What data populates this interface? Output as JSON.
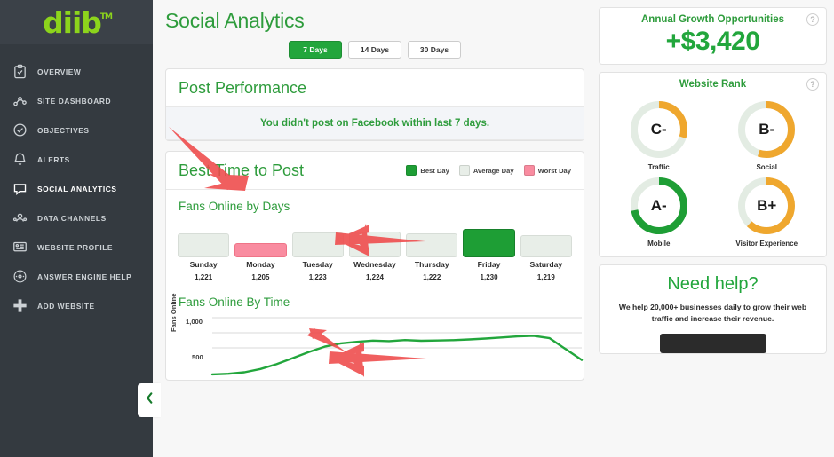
{
  "sidebar": {
    "logo": {
      "text": "diib",
      "tm": "TM",
      "color": "#8cd41c"
    },
    "items": [
      {
        "label": "Overview",
        "icon": "clipboard-check-icon",
        "active": false
      },
      {
        "label": "Site Dashboard",
        "icon": "network-graph-icon",
        "active": false
      },
      {
        "label": "Objectives",
        "icon": "check-circle-icon",
        "active": false
      },
      {
        "label": "Alerts",
        "icon": "bell-icon",
        "active": false
      },
      {
        "label": "Social Analytics",
        "icon": "chat-bubble-icon",
        "active": true
      },
      {
        "label": "Data Channels",
        "icon": "users-icon",
        "active": false
      },
      {
        "label": "Website Profile",
        "icon": "monitor-icon",
        "active": false
      },
      {
        "label": "Answer Engine Help",
        "icon": "compass-icon",
        "active": false
      },
      {
        "label": "Add Website",
        "icon": "plus-icon",
        "active": false
      }
    ],
    "collapse_icon": "chevron-left-icon"
  },
  "header": {
    "title": "Social Analytics"
  },
  "range_tabs": [
    {
      "label": "7 Days",
      "active": true
    },
    {
      "label": "14 Days",
      "active": false
    },
    {
      "label": "30 Days",
      "active": false
    }
  ],
  "post_performance": {
    "title": "Post Performance",
    "notice": "You didn't post on Facebook within last 7 days."
  },
  "best_time": {
    "title": "Best Time to Post",
    "legend": [
      {
        "label": "Best Day",
        "color": "#1e9e35"
      },
      {
        "label": "Average Day",
        "color": "#e8eee8"
      },
      {
        "label": "Worst Day",
        "color": "#f98ca0"
      }
    ],
    "fans_by_days_title": "Fans Online by Days",
    "fans_by_time_title": "Fans Online By Time"
  },
  "chart_data": [
    {
      "type": "bar",
      "title": "Fans Online by Days",
      "categories": [
        "Sunday",
        "Monday",
        "Tuesday",
        "Wednesday",
        "Thursday",
        "Friday",
        "Saturday"
      ],
      "values": [
        1221,
        1205,
        1223,
        1224,
        1222,
        1230,
        1219
      ],
      "value_labels": [
        "1,221",
        "1,205",
        "1,223",
        "1,224",
        "1,222",
        "1,230",
        "1,219"
      ],
      "statuses": [
        "average",
        "worst",
        "average",
        "average",
        "average",
        "best",
        "average"
      ],
      "colors": [
        "#e8eee8",
        "#f98ca0",
        "#e8eee8",
        "#e8eee8",
        "#e8eee8",
        "#1e9e35",
        "#e8eee8"
      ],
      "xlabel": "",
      "ylabel": "",
      "grid": false,
      "legend_position": "top-right"
    },
    {
      "type": "line",
      "title": "Fans Online By Time",
      "ylabel": "Fans Online",
      "xlabel": "",
      "ylim": [
        0,
        1000
      ],
      "yticks": [
        500,
        1000
      ],
      "ytick_labels": [
        "500",
        "1,000"
      ],
      "grid": true,
      "series": [
        {
          "name": "Fans Online",
          "color": "#22a63c",
          "values": [
            60,
            70,
            95,
            150,
            230,
            330,
            430,
            520,
            575,
            600,
            620,
            612,
            630,
            618,
            622,
            628,
            640,
            655,
            672,
            690,
            700,
            660,
            480,
            300
          ]
        }
      ]
    }
  ],
  "right_panel": {
    "growth": {
      "title": "Annual Growth Opportunities",
      "value": "+$3,420",
      "help_icon": "question-mark-icon"
    },
    "website_rank": {
      "title": "Website Rank",
      "help_icon": "question-mark-icon",
      "gauges": [
        {
          "label": "Traffic",
          "grade": "C-",
          "percent": 30,
          "color": "#efa72e"
        },
        {
          "label": "Social",
          "grade": "B-",
          "percent": 55,
          "color": "#efa72e"
        },
        {
          "label": "Mobile",
          "grade": "A-",
          "percent": 72,
          "color": "#1e9e35"
        },
        {
          "label": "Visitor Experience",
          "grade": "B+",
          "percent": 62,
          "color": "#efa72e"
        }
      ],
      "track_color": "#e3ece3"
    },
    "need_help": {
      "title": "Need help?",
      "body": "We help 20,000+ businesses daily to grow their web traffic and increase their revenue."
    }
  },
  "annotations": {
    "color": "#ef4a4a",
    "arrows": [
      {
        "name": "arrow-to-post-performance",
        "direction": "down-right"
      },
      {
        "name": "arrow-to-best-time-to-post",
        "direction": "left"
      },
      {
        "name": "arrow-to-fans-online-by-time",
        "direction": "left"
      },
      {
        "name": "arrow-to-day-values",
        "direction": "up-right"
      }
    ]
  }
}
